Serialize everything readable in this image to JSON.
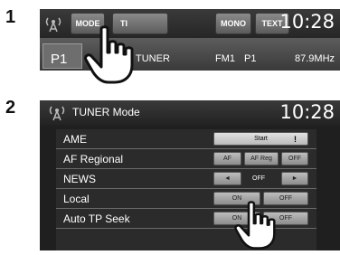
{
  "steps": [
    "1",
    "2"
  ],
  "screen1": {
    "buttons": [
      "MODE",
      "TI",
      "MONO",
      "TEXT"
    ],
    "clock": "10:28",
    "preset": "P1",
    "source": "TUNER",
    "band": "FM1",
    "preset_small": "P1",
    "frequency": "87.9MHz"
  },
  "screen2": {
    "title": "TUNER Mode",
    "clock": "10:28",
    "rows": [
      {
        "label": "AME",
        "controls": [
          "Start",
          "!"
        ]
      },
      {
        "label": "AF Regional",
        "controls": [
          "AF",
          "AF Reg",
          "OFF"
        ]
      },
      {
        "label": "NEWS",
        "controls": [
          "◄",
          "OFF",
          "►"
        ]
      },
      {
        "label": "Local",
        "controls": [
          "ON",
          "OFF"
        ]
      },
      {
        "label": "Auto TP Seek",
        "controls": [
          "ON",
          "OFF"
        ]
      }
    ]
  },
  "icons": {
    "antenna": "antenna-icon",
    "hand": "hand-pointer-icon"
  }
}
